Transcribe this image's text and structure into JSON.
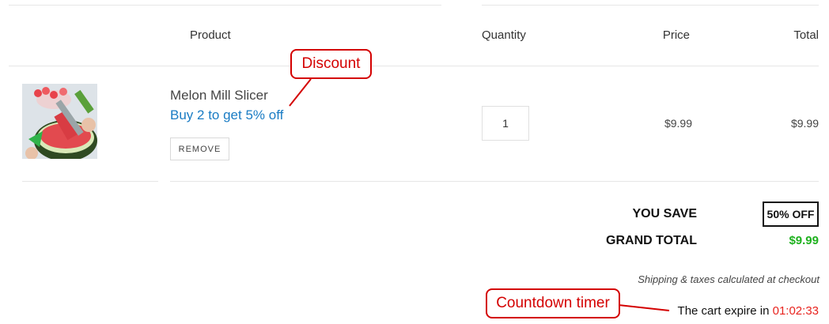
{
  "table": {
    "headers": {
      "product": "Product",
      "quantity": "Quantity",
      "price": "Price",
      "total": "Total"
    }
  },
  "item": {
    "name": "Melon Mill Slicer",
    "offer": "Buy 2 to get 5% off",
    "remove_label": "REMOVE",
    "quantity": "1",
    "price": "$9.99",
    "total": "$9.99",
    "image_icon": "watermelon-slicer-product-image"
  },
  "summary": {
    "you_save_label": "YOU SAVE",
    "you_save_value": "50% OFF",
    "grand_total_label": "GRAND TOTAL",
    "grand_total_value": "$9.99",
    "shipping_note": "Shipping & taxes calculated at checkout",
    "timer_label": "The cart expire in",
    "timer_value": "01:02:33"
  },
  "annotations": {
    "discount": "Discount",
    "countdown": "Countdown timer"
  },
  "colors": {
    "offer_blue": "#1a7cc4",
    "grand_total_green": "#1fb11f",
    "timer_red": "#e8231e",
    "callout_red": "#d40000"
  }
}
